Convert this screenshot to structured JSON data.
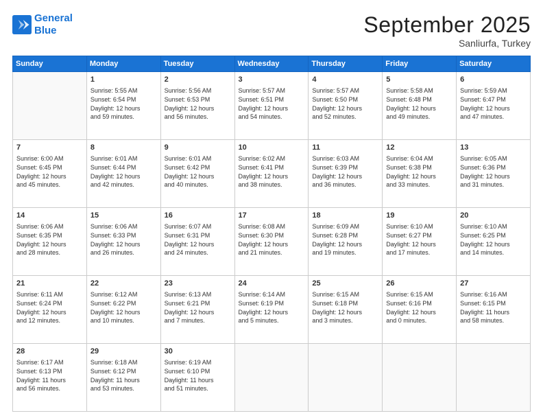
{
  "logo": {
    "line1": "General",
    "line2": "Blue"
  },
  "header": {
    "month": "September 2025",
    "location": "Sanliurfa, Turkey"
  },
  "weekdays": [
    "Sunday",
    "Monday",
    "Tuesday",
    "Wednesday",
    "Thursday",
    "Friday",
    "Saturday"
  ],
  "weeks": [
    [
      {
        "day": "",
        "info": ""
      },
      {
        "day": "1",
        "info": "Sunrise: 5:55 AM\nSunset: 6:54 PM\nDaylight: 12 hours\nand 59 minutes."
      },
      {
        "day": "2",
        "info": "Sunrise: 5:56 AM\nSunset: 6:53 PM\nDaylight: 12 hours\nand 56 minutes."
      },
      {
        "day": "3",
        "info": "Sunrise: 5:57 AM\nSunset: 6:51 PM\nDaylight: 12 hours\nand 54 minutes."
      },
      {
        "day": "4",
        "info": "Sunrise: 5:57 AM\nSunset: 6:50 PM\nDaylight: 12 hours\nand 52 minutes."
      },
      {
        "day": "5",
        "info": "Sunrise: 5:58 AM\nSunset: 6:48 PM\nDaylight: 12 hours\nand 49 minutes."
      },
      {
        "day": "6",
        "info": "Sunrise: 5:59 AM\nSunset: 6:47 PM\nDaylight: 12 hours\nand 47 minutes."
      }
    ],
    [
      {
        "day": "7",
        "info": "Sunrise: 6:00 AM\nSunset: 6:45 PM\nDaylight: 12 hours\nand 45 minutes."
      },
      {
        "day": "8",
        "info": "Sunrise: 6:01 AM\nSunset: 6:44 PM\nDaylight: 12 hours\nand 42 minutes."
      },
      {
        "day": "9",
        "info": "Sunrise: 6:01 AM\nSunset: 6:42 PM\nDaylight: 12 hours\nand 40 minutes."
      },
      {
        "day": "10",
        "info": "Sunrise: 6:02 AM\nSunset: 6:41 PM\nDaylight: 12 hours\nand 38 minutes."
      },
      {
        "day": "11",
        "info": "Sunrise: 6:03 AM\nSunset: 6:39 PM\nDaylight: 12 hours\nand 36 minutes."
      },
      {
        "day": "12",
        "info": "Sunrise: 6:04 AM\nSunset: 6:38 PM\nDaylight: 12 hours\nand 33 minutes."
      },
      {
        "day": "13",
        "info": "Sunrise: 6:05 AM\nSunset: 6:36 PM\nDaylight: 12 hours\nand 31 minutes."
      }
    ],
    [
      {
        "day": "14",
        "info": "Sunrise: 6:06 AM\nSunset: 6:35 PM\nDaylight: 12 hours\nand 28 minutes."
      },
      {
        "day": "15",
        "info": "Sunrise: 6:06 AM\nSunset: 6:33 PM\nDaylight: 12 hours\nand 26 minutes."
      },
      {
        "day": "16",
        "info": "Sunrise: 6:07 AM\nSunset: 6:31 PM\nDaylight: 12 hours\nand 24 minutes."
      },
      {
        "day": "17",
        "info": "Sunrise: 6:08 AM\nSunset: 6:30 PM\nDaylight: 12 hours\nand 21 minutes."
      },
      {
        "day": "18",
        "info": "Sunrise: 6:09 AM\nSunset: 6:28 PM\nDaylight: 12 hours\nand 19 minutes."
      },
      {
        "day": "19",
        "info": "Sunrise: 6:10 AM\nSunset: 6:27 PM\nDaylight: 12 hours\nand 17 minutes."
      },
      {
        "day": "20",
        "info": "Sunrise: 6:10 AM\nSunset: 6:25 PM\nDaylight: 12 hours\nand 14 minutes."
      }
    ],
    [
      {
        "day": "21",
        "info": "Sunrise: 6:11 AM\nSunset: 6:24 PM\nDaylight: 12 hours\nand 12 minutes."
      },
      {
        "day": "22",
        "info": "Sunrise: 6:12 AM\nSunset: 6:22 PM\nDaylight: 12 hours\nand 10 minutes."
      },
      {
        "day": "23",
        "info": "Sunrise: 6:13 AM\nSunset: 6:21 PM\nDaylight: 12 hours\nand 7 minutes."
      },
      {
        "day": "24",
        "info": "Sunrise: 6:14 AM\nSunset: 6:19 PM\nDaylight: 12 hours\nand 5 minutes."
      },
      {
        "day": "25",
        "info": "Sunrise: 6:15 AM\nSunset: 6:18 PM\nDaylight: 12 hours\nand 3 minutes."
      },
      {
        "day": "26",
        "info": "Sunrise: 6:15 AM\nSunset: 6:16 PM\nDaylight: 12 hours\nand 0 minutes."
      },
      {
        "day": "27",
        "info": "Sunrise: 6:16 AM\nSunset: 6:15 PM\nDaylight: 11 hours\nand 58 minutes."
      }
    ],
    [
      {
        "day": "28",
        "info": "Sunrise: 6:17 AM\nSunset: 6:13 PM\nDaylight: 11 hours\nand 56 minutes."
      },
      {
        "day": "29",
        "info": "Sunrise: 6:18 AM\nSunset: 6:12 PM\nDaylight: 11 hours\nand 53 minutes."
      },
      {
        "day": "30",
        "info": "Sunrise: 6:19 AM\nSunset: 6:10 PM\nDaylight: 11 hours\nand 51 minutes."
      },
      {
        "day": "",
        "info": ""
      },
      {
        "day": "",
        "info": ""
      },
      {
        "day": "",
        "info": ""
      },
      {
        "day": "",
        "info": ""
      }
    ]
  ]
}
